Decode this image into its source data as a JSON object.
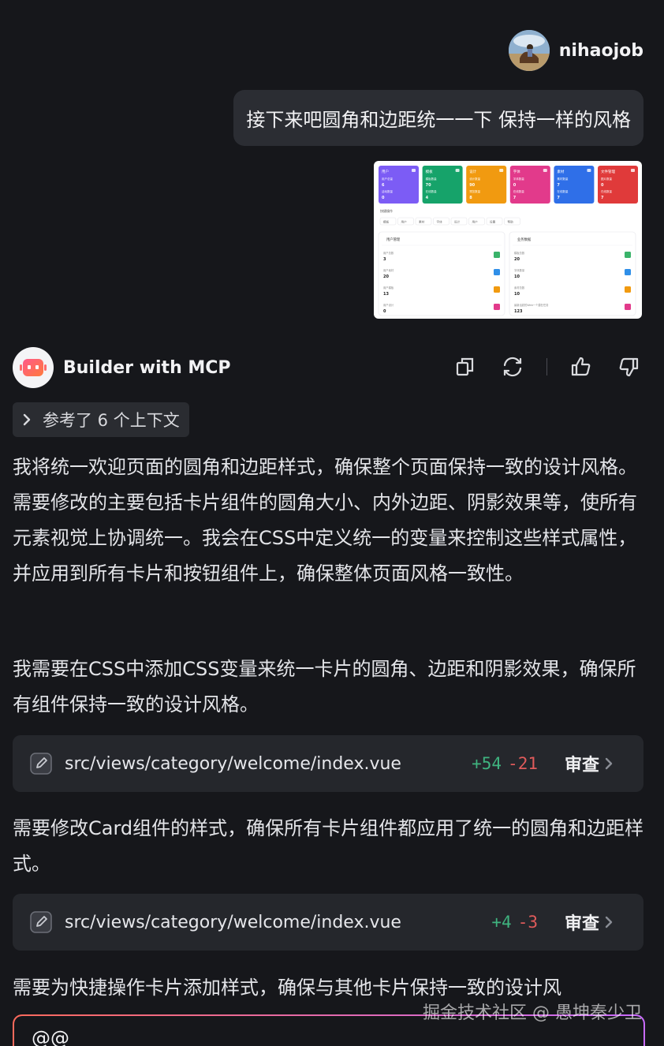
{
  "user": {
    "name": "nihaojob",
    "message": "接下来吧圆角和边距统一一下 保持一样的风格"
  },
  "attachment": {
    "cards": [
      {
        "title": "用户",
        "color": "#7c5cf5",
        "rows": [
          "用户总量",
          "6",
          "活动数量",
          "0"
        ]
      },
      {
        "title": "模板",
        "color": "#16a36a",
        "rows": [
          "模板数量",
          "70",
          "在线数量",
          "4"
        ]
      },
      {
        "title": "设计",
        "color": "#f19a10",
        "rows": [
          "设计数量",
          "90",
          "预览数量",
          "8"
        ]
      },
      {
        "title": "字体",
        "color": "#e23a8b",
        "rows": [
          "字体数量",
          "0",
          "在线数量",
          "7"
        ]
      },
      {
        "title": "素材",
        "color": "#2f6fe8",
        "rows": [
          "素材数量",
          "7",
          "在线数量",
          "7"
        ]
      },
      {
        "title": "文件管理",
        "color": "#e03a3a",
        "rows": [
          "图片数量",
          "0",
          "在线数量",
          "7"
        ]
      }
    ],
    "quick_title": "快捷操作",
    "quick_items": [
      "模板",
      "用户",
      "素材",
      "字体",
      "设计",
      "用户",
      "设置",
      "帮助"
    ],
    "panels": [
      {
        "title": "用户管理",
        "rows": [
          [
            "用户总数",
            "3"
          ],
          [
            "用户素材",
            "20"
          ],
          [
            "用户模板",
            "13"
          ],
          [
            "用户设计",
            "0"
          ]
        ]
      },
      {
        "title": "业务数据",
        "rows": [
          [
            "模板总数",
            "20"
          ],
          [
            "字体数量",
            "10"
          ],
          [
            "素材总数",
            "10"
          ],
          [
            "最新活跃的Web一个潜在任务",
            "123"
          ]
        ]
      }
    ]
  },
  "assistant": {
    "name": "Builder with MCP",
    "actions": [
      "copy-icon",
      "refresh-icon",
      "thumbs-up-icon",
      "thumbs-down-icon"
    ],
    "context_label": "参考了 6 个上下文",
    "paragraph1": "我将统一欢迎页面的圆角和边距样式，确保整个页面保持一致的设计风格。需要修改的主要包括卡片组件的圆角大小、内外边距、阴影效果等，使所有元素视觉上协调统一。我会在CSS中定义统一的变量来控制这些样式属性，并应用到所有卡片和按钮组件上，确保整体页面风格一致性。",
    "paragraph2": "我需要在CSS中添加CSS变量来统一卡片的圆角、边距和阴影效果，确保所有组件保持一致的设计风格。",
    "file1": {
      "path": "src/views/category/welcome/index.vue",
      "added": "+54",
      "removed": "-21",
      "review": "审查"
    },
    "paragraph3": "需要修改Card组件的样式，确保所有卡片组件都应用了统一的圆角和边距样式。",
    "file2": {
      "path": "src/views/category/welcome/index.vue",
      "added": "+4",
      "removed": "-3",
      "review": "审查"
    },
    "paragraph4": "需要为快捷操作卡片添加样式，确保与其他卡片保持一致的设计风"
  },
  "input": {
    "value": "@@"
  },
  "watermark": "掘金技术社区 @ 愚坤秦少卫",
  "colors": {
    "background": "#16171b",
    "bubble": "#2b2d33",
    "card": "#25272c",
    "added": "#3fb37f",
    "removed": "#e05b5b"
  }
}
